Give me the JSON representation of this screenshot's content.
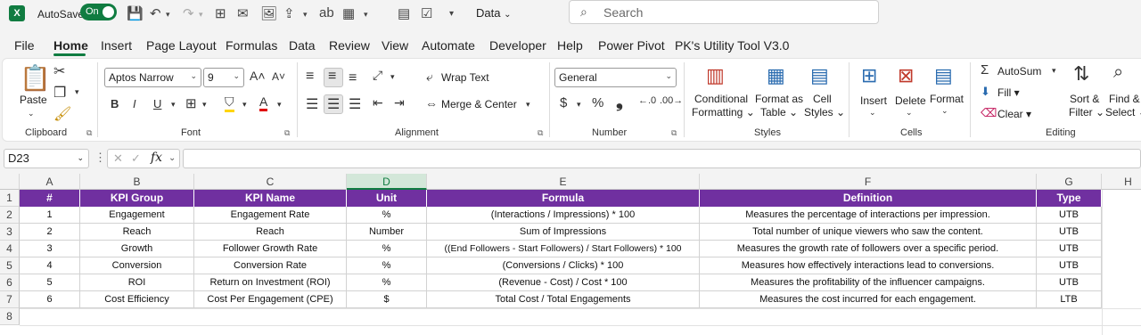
{
  "titlebar": {
    "app_icon": "X",
    "autosave_label": "AutoSave",
    "autosave_state": "On",
    "data_label": "Data",
    "search_placeholder": "Search"
  },
  "tabs": [
    "File",
    "Home",
    "Insert",
    "Page Layout",
    "Formulas",
    "Data",
    "Review",
    "View",
    "Automate",
    "Developer",
    "Help",
    "Power Pivot",
    "PK's Utility Tool V3.0"
  ],
  "active_tab": "Home",
  "ribbon": {
    "clipboard": {
      "paste": "Paste",
      "label": "Clipboard"
    },
    "font": {
      "name": "Aptos Narrow",
      "size": "9",
      "label": "Font",
      "bold": "B",
      "italic": "I",
      "underline": "U"
    },
    "alignment": {
      "wrap": "Wrap Text",
      "merge": "Merge & Center",
      "label": "Alignment"
    },
    "number": {
      "format": "General",
      "label": "Number",
      "currency": "$",
      "percent": "%",
      "comma": "❟"
    },
    "styles": {
      "cond1": "Conditional",
      "cond2": "Formatting",
      "fmt1": "Format as",
      "fmt2": "Table",
      "cell1": "Cell",
      "cell2": "Styles",
      "label": "Styles"
    },
    "cells": {
      "insert": "Insert",
      "delete": "Delete",
      "format": "Format",
      "label": "Cells"
    },
    "editing": {
      "autosum": "AutoSum",
      "fill": "Fill",
      "clear": "Clear",
      "sort1": "Sort &",
      "sort2": "Filter",
      "find1": "Find &",
      "find2": "Select",
      "label": "Editing"
    }
  },
  "formula_bar": {
    "name_box": "D23",
    "fx": "fx",
    "value": ""
  },
  "columns": [
    "A",
    "B",
    "C",
    "D",
    "E",
    "F",
    "G",
    "H"
  ],
  "selected_column": "D",
  "rows": [
    "1",
    "2",
    "3",
    "4",
    "5",
    "6",
    "7",
    "8"
  ],
  "table": {
    "headers": [
      "#",
      "KPI Group",
      "KPI Name",
      "Unit",
      "Formula",
      "Definition",
      "Type"
    ],
    "header_color": "#7030a0",
    "data": [
      [
        "1",
        "Engagement",
        "Engagement Rate",
        "%",
        "(Interactions / Impressions) * 100",
        "Measures the percentage of interactions per impression.",
        "UTB"
      ],
      [
        "2",
        "Reach",
        "Reach",
        "Number",
        "Sum of Impressions",
        "Total number of unique viewers who saw the content.",
        "UTB"
      ],
      [
        "3",
        "Growth",
        "Follower Growth Rate",
        "%",
        "((End Followers - Start Followers) / Start Followers) * 100",
        "Measures the growth rate of followers over a specific period.",
        "UTB"
      ],
      [
        "4",
        "Conversion",
        "Conversion Rate",
        "%",
        "(Conversions / Clicks) * 100",
        "Measures how effectively interactions lead to conversions.",
        "UTB"
      ],
      [
        "5",
        "ROI",
        "Return on Investment (ROI)",
        "%",
        "(Revenue - Cost) / Cost * 100",
        "Measures the profitability of the influencer campaigns.",
        "UTB"
      ],
      [
        "6",
        "Cost Efficiency",
        "Cost Per Engagement (CPE)",
        "$",
        "Total Cost / Total Engagements",
        "Measures the cost incurred for each engagement.",
        "LTB"
      ]
    ]
  }
}
